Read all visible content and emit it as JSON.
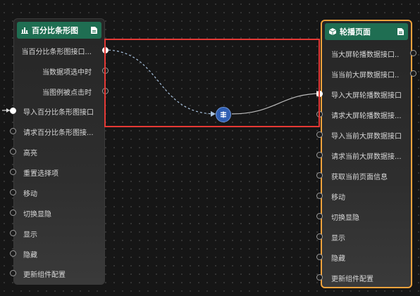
{
  "left_node": {
    "title": "百分比条形图",
    "title_icon": "bar-chart-icon",
    "doc_icon": "document-icon",
    "ports": [
      {
        "label": "当百分比条形图接口...",
        "side": "right",
        "active": true
      },
      {
        "label": "当数据项选中时",
        "side": "right",
        "active": false
      },
      {
        "label": "当图例被点击时",
        "side": "right",
        "active": false
      },
      {
        "label": "导入百分比条形图接口",
        "side": "left",
        "active": true
      },
      {
        "label": "请求百分比条形图接...",
        "side": "left",
        "active": false
      },
      {
        "label": "高亮",
        "side": "left",
        "active": false
      },
      {
        "label": "重置选择项",
        "side": "left",
        "active": false
      },
      {
        "label": "移动",
        "side": "left",
        "active": false
      },
      {
        "label": "切换显隐",
        "side": "left",
        "active": false
      },
      {
        "label": "显示",
        "side": "left",
        "active": false
      },
      {
        "label": "隐藏",
        "side": "left",
        "active": false
      },
      {
        "label": "更新组件配置",
        "side": "left",
        "active": false
      }
    ]
  },
  "right_node": {
    "title": "轮播页面",
    "title_icon": "cube-icon",
    "doc_icon": "document-icon",
    "border_color": "#f0a23c",
    "ports": [
      {
        "label": "当大屏轮播数据接口...",
        "side": "right",
        "active": false
      },
      {
        "label": "当当前大屏数据接口...",
        "side": "right",
        "active": false
      },
      {
        "label": "导入大屏轮播数据接口",
        "side": "left",
        "active": true
      },
      {
        "label": "请求大屏轮播数据接...",
        "side": "left",
        "active": false
      },
      {
        "label": "导入当前大屏数据接口",
        "side": "left",
        "active": false
      },
      {
        "label": "请求当前大屏数据接...",
        "side": "left",
        "active": false
      },
      {
        "label": "获取当前页面信息",
        "side": "left",
        "active": false
      },
      {
        "label": "移动",
        "side": "left",
        "active": false
      },
      {
        "label": "切换显隐",
        "side": "left",
        "active": false
      },
      {
        "label": "显示",
        "side": "left",
        "active": false
      },
      {
        "label": "隐藏",
        "side": "left",
        "active": false
      },
      {
        "label": "更新组件配置",
        "side": "left",
        "active": false
      }
    ]
  },
  "connector": {
    "icon": "transform-icon",
    "color": "#2f5fb3"
  },
  "selection": {
    "color": "#e53935"
  },
  "header_color": "#1f6e52"
}
